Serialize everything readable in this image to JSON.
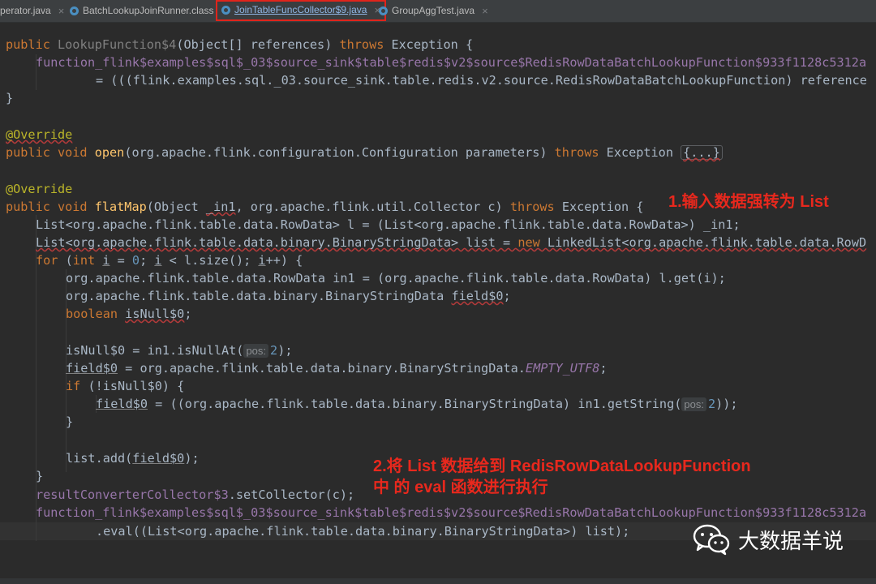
{
  "tabs": [
    {
      "label": "perator.java"
    },
    {
      "label": "BatchLookupJoinRunner.class"
    },
    {
      "label": "JoinTableFuncCollector$9.java",
      "active": true
    },
    {
      "label": "GroupAggTest.java"
    }
  ],
  "code": {
    "l1": [
      "public ",
      "LookupFunction$4",
      "(Object[] references) ",
      "throws",
      " Exception {"
    ],
    "l2": "function_flink$examples$sql$_03$source_sink$table$redis$v2$source$RedisRowDataBatchLookupFunction$933f1128c5312a",
    "l3": "= (((flink.examples.sql._03.source_sink.table.redis.v2.source.RedisRowDataBatchLookupFunction) reference",
    "l4": "}",
    "l5": "@Override",
    "l6": [
      "public void ",
      "open",
      "(org.apache.flink.configuration.Configuration parameters) ",
      "throws",
      " Exception ",
      "{...}"
    ],
    "l7": "@Override",
    "l8": [
      "public void ",
      "flatMap",
      "(Object ",
      "_in1",
      ", org.apache.flink.util.Collector c) ",
      "throws",
      " Exception {"
    ],
    "l9": "List<org.apache.flink.table.data.RowData> l = (List<org.apache.flink.table.data.RowData>) _in1;",
    "l10": [
      "List<org.apache.flink.table.data.binary.BinaryStringData> list = ",
      "new",
      " LinkedList<org.apache.flink.table.data.RowD"
    ],
    "l11": [
      "for",
      " (",
      "int",
      " ",
      "i",
      " = ",
      "0",
      "; ",
      "i",
      " < l.size(); ",
      "i",
      "++) {"
    ],
    "l12": "org.apache.flink.table.data.RowData in1 = (org.apache.flink.table.data.RowData) l.get(i);",
    "l13": [
      "org.apache.flink.table.data.binary.BinaryStringData ",
      "field$0",
      ";"
    ],
    "l14": [
      "boolean",
      " ",
      "isNull$0",
      ";"
    ],
    "l15": [
      "isNull$0 = in1.isNullAt(",
      "pos:",
      "2",
      ");"
    ],
    "l16": [
      "field$0",
      " = org.apache.flink.table.data.binary.BinaryStringData.",
      "EMPTY_UTF8",
      ";"
    ],
    "l17": [
      "if",
      " (!isNull$0) {"
    ],
    "l18": [
      "field$0",
      " = ((org.apache.flink.table.data.binary.BinaryStringData) in1.getString(",
      "pos:",
      "2",
      "));"
    ],
    "l19": "}",
    "l20": [
      "list.add(",
      "field$0",
      ");"
    ],
    "l21": "}",
    "l22": [
      "resultConverterCollector$3",
      ".setCollector(c);"
    ],
    "l23": "function_flink$examples$sql$_03$source_sink$table$redis$v2$source$RedisRowDataBatchLookupFunction$933f1128c5312a",
    "l24": ".eval((List<org.apache.flink.table.data.binary.BinaryStringData>) list);"
  },
  "annotations": {
    "note1": "1.输入数据强转为 List",
    "note2": "2.将 List 数据给到 RedisRowDataLookupFunction\n中 的 eval 函数进行执行"
  },
  "watermark": {
    "text": "大数据羊说",
    "icon": "wechat-icon"
  },
  "colors": {
    "background": "#2b2b2b",
    "keyword": "#cc7832",
    "method": "#ffc66d",
    "annotation": "#bbb529",
    "field": "#9876aa",
    "annotation_note": "#e8281d",
    "active_tab_outline": "#e0241b"
  }
}
